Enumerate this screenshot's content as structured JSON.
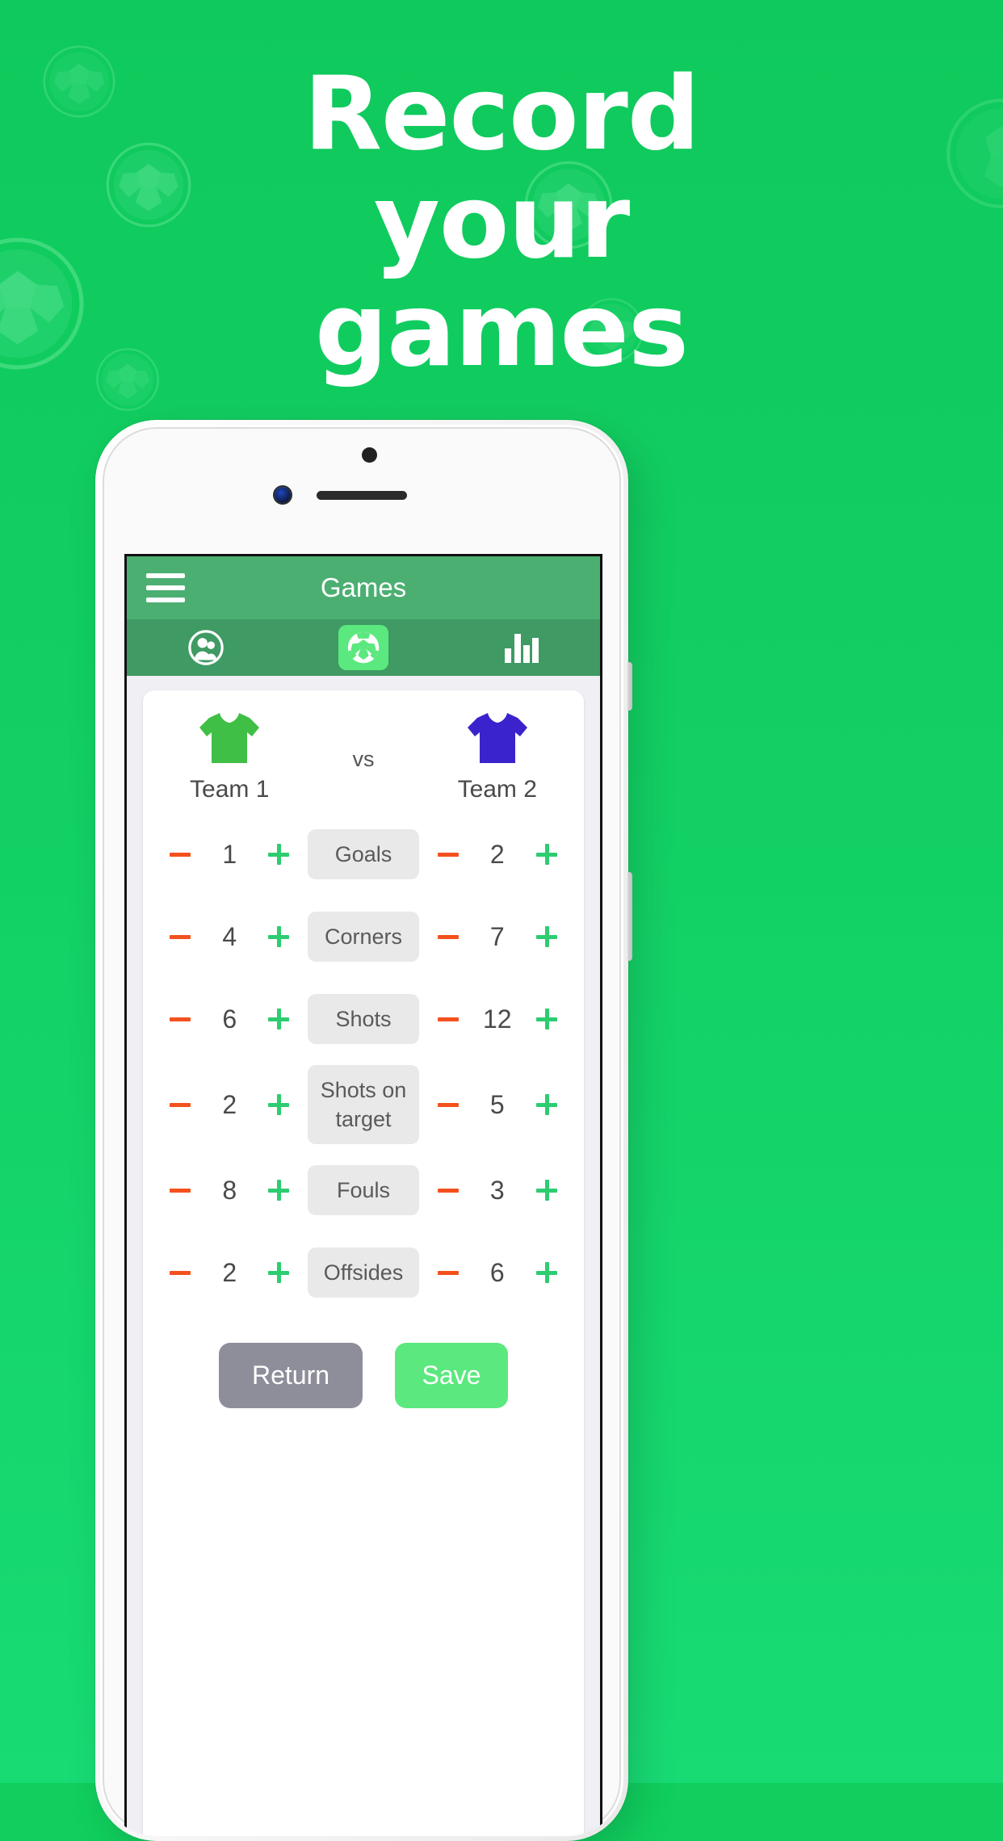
{
  "promo": {
    "headline_lines": [
      "Record",
      "your",
      "games"
    ],
    "background_color": "#10CF5E",
    "accent_color": "#5BE87E"
  },
  "app": {
    "appbar": {
      "menu_icon": "hamburger-menu-icon",
      "title": "Games"
    },
    "tabs": [
      {
        "icon": "people-icon",
        "name": "teams",
        "active": false
      },
      {
        "icon": "soccer-ball-icon",
        "name": "games",
        "active": true
      },
      {
        "icon": "bar-chart-icon",
        "name": "stats",
        "active": false
      }
    ],
    "match": {
      "vs_label": "vs",
      "home": {
        "name": "Team 1",
        "jersey_color": "#3FBF45",
        "jersey_icon": "jersey-icon"
      },
      "away": {
        "name": "Team 2",
        "jersey_color": "#3A23CC",
        "jersey_icon": "jersey-icon"
      }
    },
    "stats": [
      {
        "label": "Goals",
        "home": "1",
        "away": "2"
      },
      {
        "label": "Corners",
        "home": "4",
        "away": "7"
      },
      {
        "label": "Shots",
        "home": "6",
        "away": "12"
      },
      {
        "label": "Shots on target",
        "home": "2",
        "away": "5"
      },
      {
        "label": "Fouls",
        "home": "8",
        "away": "3"
      },
      {
        "label": "Offsides",
        "home": "2",
        "away": "6"
      }
    ],
    "stepper": {
      "minus_icon": "minus-icon",
      "plus_icon": "plus-icon",
      "minus_color": "#F4511E",
      "plus_color": "#2ECC71"
    },
    "actions": {
      "return_label": "Return",
      "save_label": "Save",
      "return_color": "#8E8E9A",
      "save_color": "#5BE87E"
    }
  }
}
